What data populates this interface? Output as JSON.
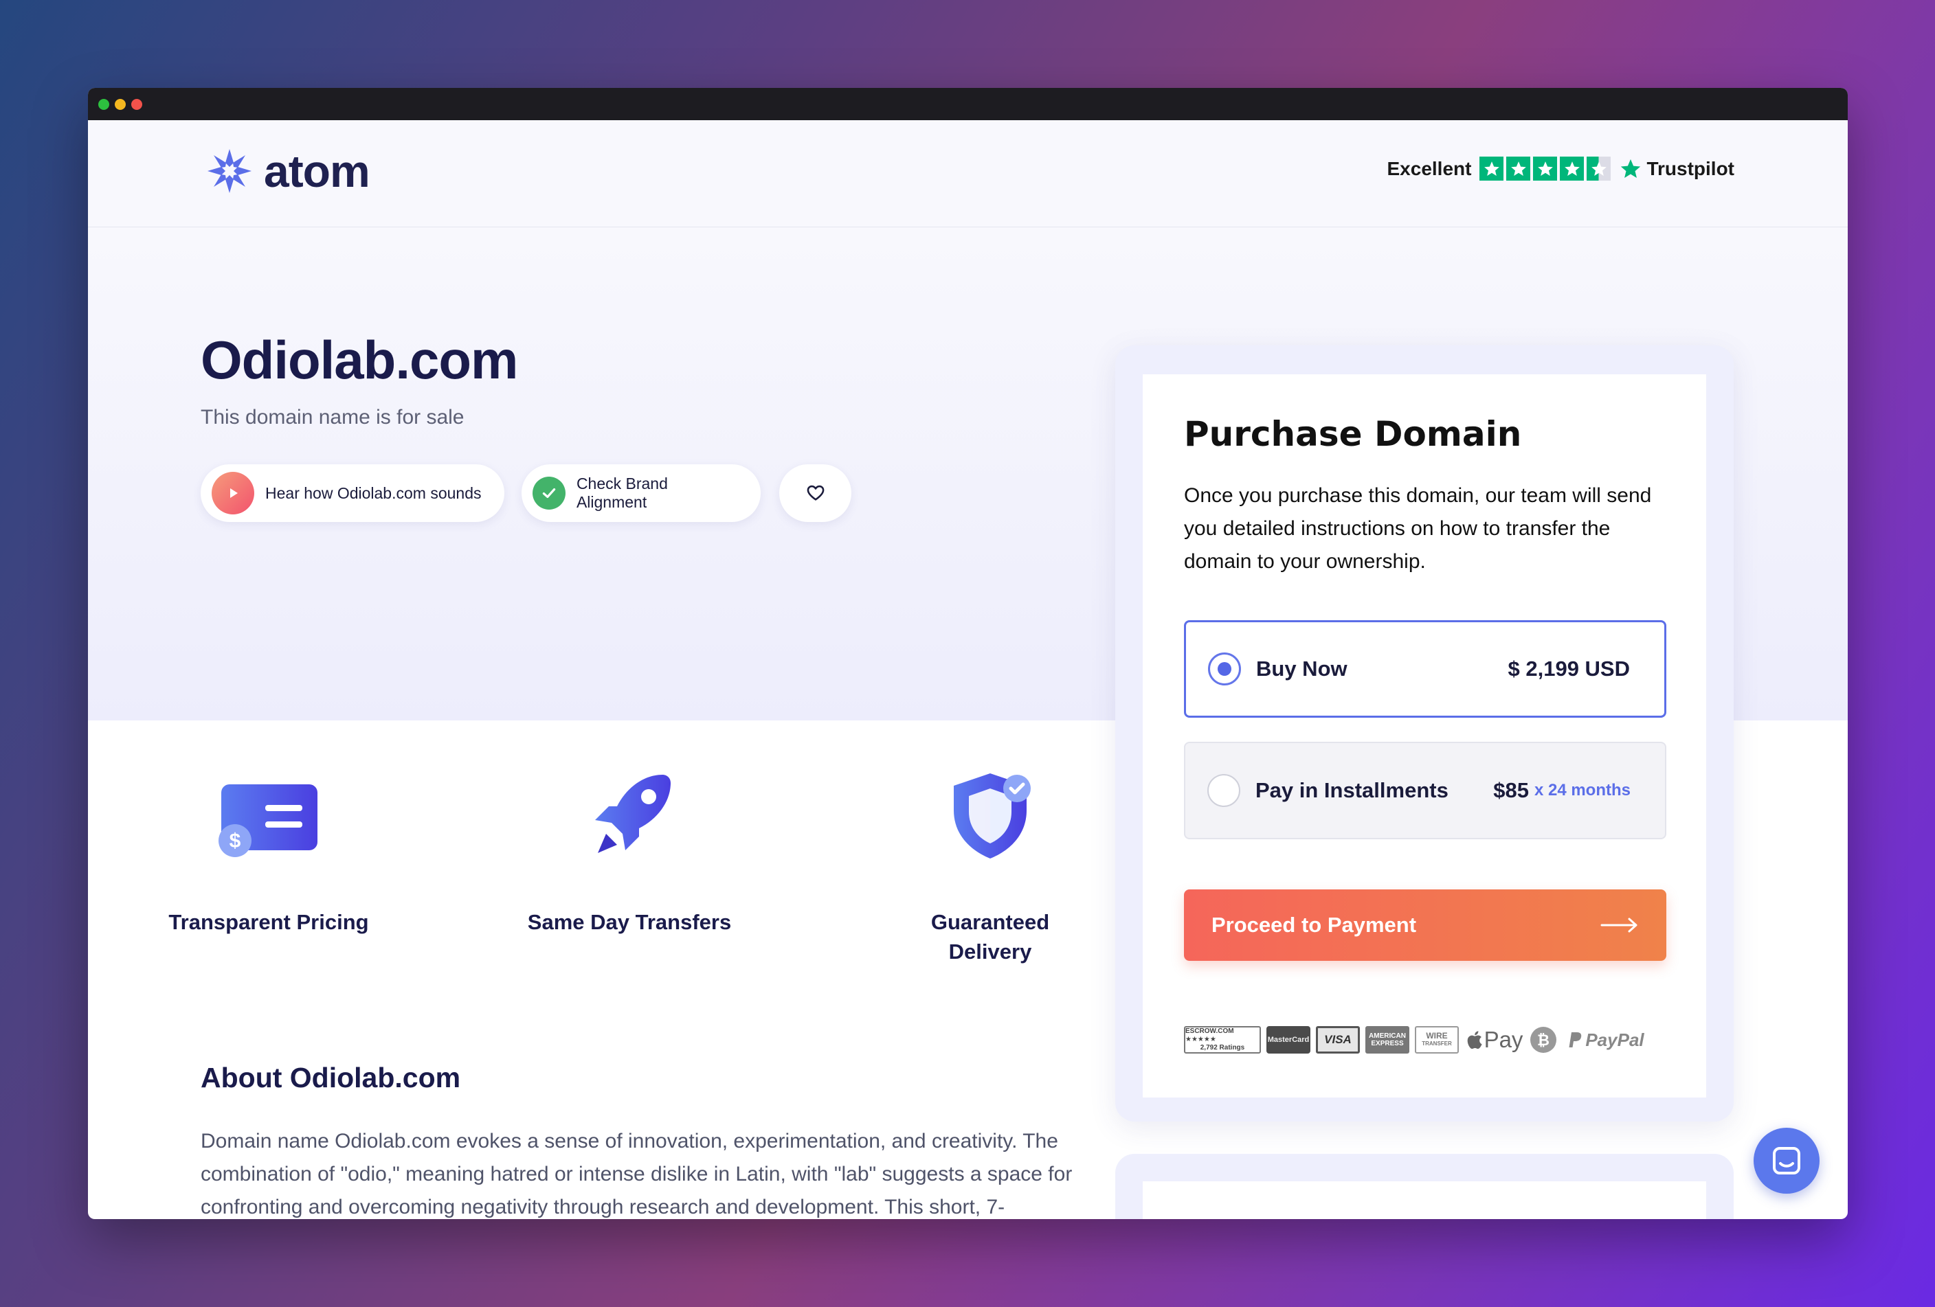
{
  "header": {
    "logo_text": "atom",
    "trust_label": "Excellent",
    "trust_brand": "Trustpilot",
    "trust_rating_stars": 4.5
  },
  "hero": {
    "title": "Odiolab.com",
    "subtitle": "This domain name is for sale",
    "sound_button": "Hear how Odiolab.com sounds",
    "brand_button": "Check Brand Alignment"
  },
  "features": [
    {
      "label": "Transparent Pricing",
      "icon": "pricing-card-icon"
    },
    {
      "label": "Same Day Transfers",
      "icon": "rocket-icon"
    },
    {
      "label": "Guaranteed Delivery",
      "icon": "shield-icon"
    }
  ],
  "about": {
    "title": "About Odiolab.com",
    "text": "Domain name Odiolab.com evokes a sense of innovation, experimentation, and creativity. The combination of \"odio,\" meaning hatred or intense dislike in Latin, with \"lab\" suggests a space for confronting and overcoming negativity through research and development. This short, 7-"
  },
  "purchase": {
    "title": "Purchase Domain",
    "description": "Once you purchase this domain, our team will send you detailed instructions on how to transfer the domain to your ownership.",
    "options": [
      {
        "label": "Buy Now",
        "price": "$ 2,199 USD",
        "selected": true
      },
      {
        "label": "Pay in Installments",
        "price": "$85",
        "months": "x 24 months",
        "selected": false
      }
    ],
    "cta": "Proceed to Payment",
    "payment_methods": {
      "escrow_line1": "ESCROW.COM ★★★★★",
      "escrow_line2": "2,792 Ratings",
      "mastercard": "MasterCard",
      "visa": "VISA",
      "amex": "AMERICAN EXPRESS",
      "wire_line1": "WIRE",
      "wire_line2": "TRANSFER",
      "apple_pay": "Pay",
      "paypal": "PayPal"
    }
  },
  "colors": {
    "accent": "#5b6ee8",
    "cta_start": "#f5665a",
    "cta_end": "#f0824a",
    "heading": "#1a1b4b",
    "trustpilot": "#00b67a"
  }
}
